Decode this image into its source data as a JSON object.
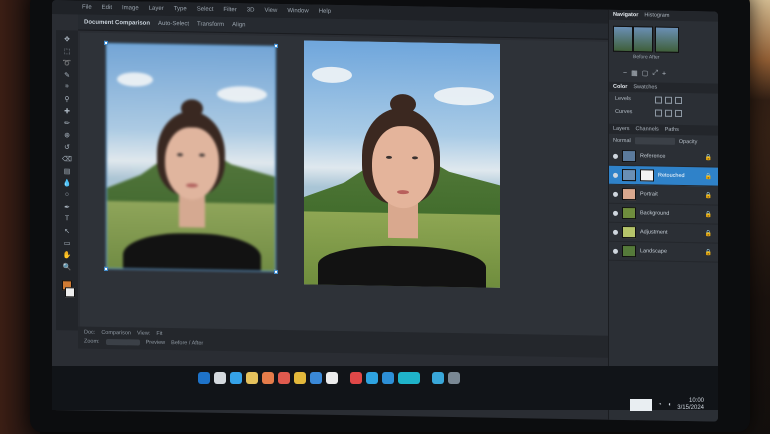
{
  "menubar": {
    "items": [
      "File",
      "Edit",
      "Image",
      "Layer",
      "Type",
      "Select",
      "Filter",
      "3D",
      "View",
      "Window",
      "Help"
    ]
  },
  "optionsbar": {
    "doc_title": "Document Comparison",
    "fields": [
      "Auto-Select",
      "Transform",
      "Align"
    ]
  },
  "toolbar": {
    "tools": [
      "move-tool-icon",
      "marquee-tool-icon",
      "lasso-tool-icon",
      "quick-select-icon",
      "crop-icon",
      "eyedropper-icon",
      "healing-brush-icon",
      "brush-icon",
      "clone-stamp-icon",
      "history-brush-icon",
      "eraser-icon",
      "gradient-icon",
      "blur-icon",
      "dodge-icon",
      "pen-icon",
      "type-icon",
      "path-select-icon",
      "shape-icon",
      "hand-icon",
      "zoom-icon"
    ],
    "tool_glyphs": [
      "✥",
      "⬚",
      "➰",
      "✎",
      "⌗",
      "⚲",
      "✚",
      "✏",
      "⊕",
      "↺",
      "⌫",
      "▤",
      "💧",
      "○",
      "✒",
      "T",
      "↖",
      "▭",
      "✋",
      "🔍"
    ]
  },
  "statusbar": {
    "line1": [
      "Doc:",
      "Comparison",
      "View:",
      "Fit"
    ],
    "line2": [
      "Zoom:",
      "Preview",
      "Before / After"
    ]
  },
  "panels": {
    "navigator_tabs": [
      "Navigator",
      "Histogram"
    ],
    "navigator_caption": "Before  After",
    "adjustments_tabs": [
      "Color",
      "Swatches"
    ],
    "adjustments_rows": [
      "Levels",
      "Curves"
    ],
    "layers_tabs": [
      "Layers",
      "Channels",
      "Paths"
    ],
    "layers_filter": "Normal",
    "layers_opacity_label": "Opacity",
    "layers": [
      {
        "name": "Reference",
        "selected": false,
        "thumb": "#5b7a9c"
      },
      {
        "name": "Retouched",
        "selected": true,
        "thumb": "#6a8fb5"
      },
      {
        "name": "Portrait",
        "selected": false,
        "thumb": "#d9a88e"
      },
      {
        "name": "Background",
        "selected": false,
        "thumb": "#6f8d3d"
      },
      {
        "name": "Adjustment",
        "selected": false,
        "thumb": "#b5c46a"
      },
      {
        "name": "Landscape",
        "selected": false,
        "thumb": "#557a3a"
      }
    ]
  },
  "taskbar": {
    "icons": [
      {
        "name": "start-icon",
        "color": "#1e73c9"
      },
      {
        "name": "files-icon",
        "color": "#d4d9de"
      },
      {
        "name": "browser-icon",
        "color": "#35a2e8"
      },
      {
        "name": "notes-icon",
        "color": "#e5c25d"
      },
      {
        "name": "photos-icon",
        "color": "#e57c4a"
      },
      {
        "name": "mail-icon",
        "color": "#df5a4e"
      },
      {
        "name": "folder-icon",
        "color": "#e3b83b"
      },
      {
        "name": "store-icon",
        "color": "#3a89d8"
      },
      {
        "name": "camera-icon",
        "color": "#ececec"
      },
      {
        "name": "media-icon",
        "color": "#e04848"
      },
      {
        "name": "edge-icon",
        "color": "#2ea3e0"
      },
      {
        "name": "chat-icon",
        "color": "#2d8fd6"
      },
      {
        "name": "app-icon",
        "color": "#1fb3c9"
      },
      {
        "name": "editor-icon",
        "color": "#39a7d9"
      },
      {
        "name": "tools-icon",
        "color": "#7a8894"
      }
    ],
    "clock_time": "10:00",
    "clock_date": "3/15/2024"
  }
}
